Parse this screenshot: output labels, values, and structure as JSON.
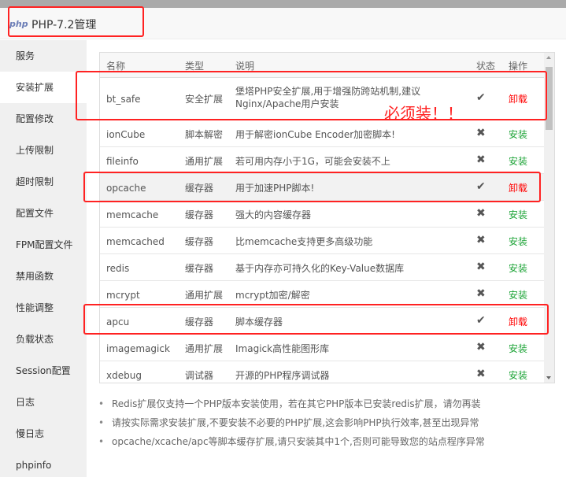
{
  "header": {
    "logo": "php",
    "title": "PHP-7.2管理"
  },
  "sidebar": {
    "items": [
      {
        "label": "服务"
      },
      {
        "label": "安装扩展",
        "active": true
      },
      {
        "label": "配置修改"
      },
      {
        "label": "上传限制"
      },
      {
        "label": "超时限制"
      },
      {
        "label": "配置文件"
      },
      {
        "label": "FPM配置文件"
      },
      {
        "label": "禁用函数"
      },
      {
        "label": "性能调整"
      },
      {
        "label": "负载状态"
      },
      {
        "label": "Session配置"
      },
      {
        "label": "日志"
      },
      {
        "label": "慢日志"
      },
      {
        "label": "phpinfo"
      }
    ]
  },
  "table": {
    "columns": {
      "name": "名称",
      "type": "类型",
      "desc": "说明",
      "status": "状态",
      "action": "操作"
    },
    "rows": [
      {
        "name": "bt_safe",
        "type": "安全扩展",
        "desc": "堡塔PHP安全扩展,用于增强防跨站机制,建议Nginx/Apache用户安装",
        "installed": true,
        "action": "卸载"
      },
      {
        "name": "ionCube",
        "type": "脚本解密",
        "desc": "用于解密ionCube Encoder加密脚本!",
        "installed": false,
        "action": "安装"
      },
      {
        "name": "fileinfo",
        "type": "通用扩展",
        "desc": "若可用内存小于1G，可能会安装不上",
        "installed": false,
        "action": "安装"
      },
      {
        "name": "opcache",
        "type": "缓存器",
        "desc": "用于加速PHP脚本!",
        "installed": true,
        "action": "卸载"
      },
      {
        "name": "memcache",
        "type": "缓存器",
        "desc": "强大的内容缓存器",
        "installed": false,
        "action": "安装"
      },
      {
        "name": "memcached",
        "type": "缓存器",
        "desc": "比memcache支持更多高级功能",
        "installed": false,
        "action": "安装"
      },
      {
        "name": "redis",
        "type": "缓存器",
        "desc": "基于内存亦可持久化的Key-Value数据库",
        "installed": false,
        "action": "安装"
      },
      {
        "name": "mcrypt",
        "type": "通用扩展",
        "desc": "mcrypt加密/解密",
        "installed": false,
        "action": "安装"
      },
      {
        "name": "apcu",
        "type": "缓存器",
        "desc": "脚本缓存器",
        "installed": true,
        "action": "卸载"
      },
      {
        "name": "imagemagick",
        "type": "通用扩展",
        "desc": "Imagick高性能图形库",
        "installed": false,
        "action": "安装"
      },
      {
        "name": "xdebug",
        "type": "调试器",
        "desc": "开源的PHP程序调试器",
        "installed": false,
        "action": "安装"
      }
    ]
  },
  "notes": [
    "Redis扩展仅支持一个PHP版本安装使用，若在其它PHP版本已安装redis扩展，请勿再装",
    "请按实际需求安装扩展,不要安装不必要的PHP扩展,这会影响PHP执行效率,甚至出现异常",
    "opcache/xcache/apc等脚本缓存扩展,请只安装其中1个,否则可能导致您的站点程序异常"
  ],
  "annotation": {
    "text": "必须装！！"
  },
  "colors": {
    "install": "#20a53a",
    "uninstall": "#ff0000",
    "annotation": "#ff2222"
  }
}
